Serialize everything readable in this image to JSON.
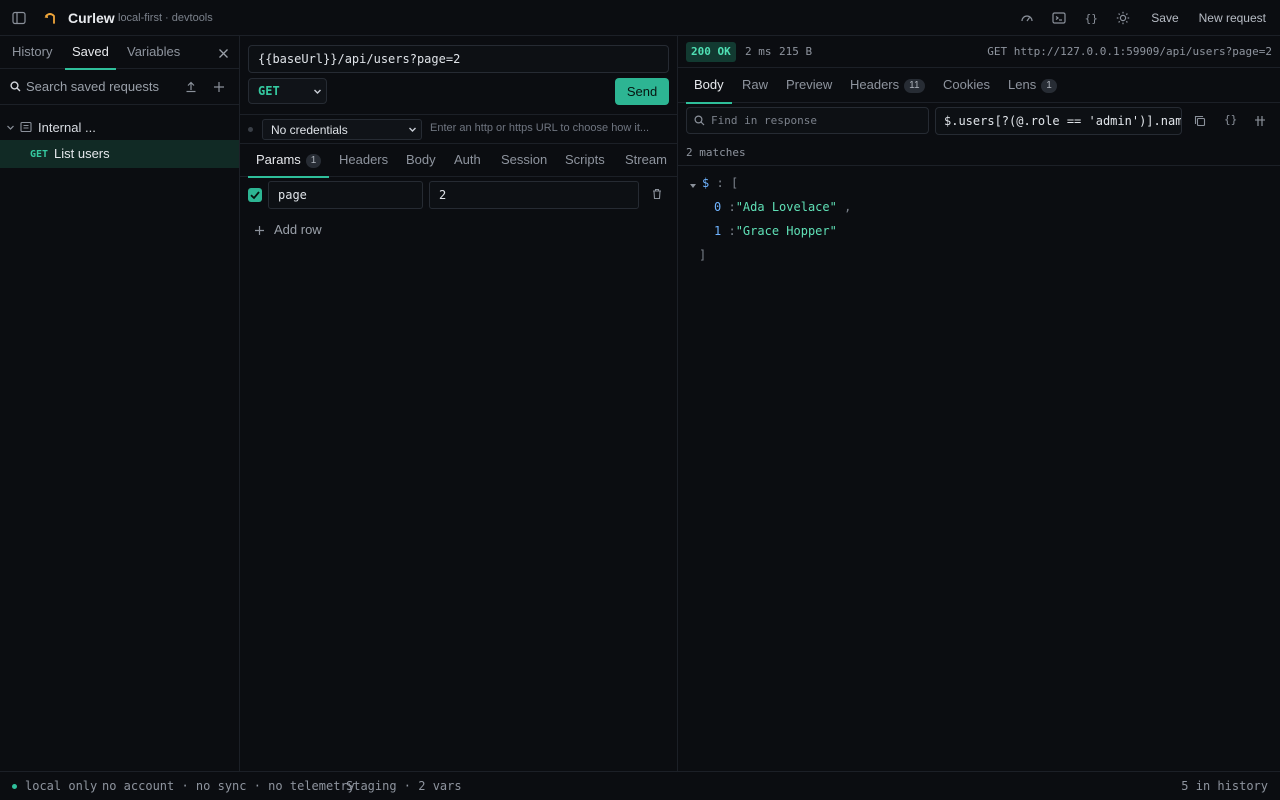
{
  "app": {
    "title": "Curlew",
    "subtitle": "local-first · devtools"
  },
  "topbar": {
    "save_label": "Save",
    "new_request_label": "New request"
  },
  "sidebar": {
    "tabs": [
      "History",
      "Saved",
      "Variables"
    ],
    "active_tab": "Saved",
    "search_placeholder": "Search saved requests",
    "folder_name": "Internal ...",
    "items": [
      {
        "method": "GET",
        "name": "List users"
      }
    ]
  },
  "request": {
    "url": "{{baseUrl}}/api/users?page=2",
    "method": "GET",
    "send_label": "Send",
    "credentials": "No credentials",
    "url_hint": "Enter an http or https URL to choose how it...",
    "tabs": [
      {
        "label": "Params",
        "badge": "1"
      },
      {
        "label": "Headers"
      },
      {
        "label": "Body"
      },
      {
        "label": "Auth"
      },
      {
        "label": "Session"
      },
      {
        "label": "Scripts"
      },
      {
        "label": "Stream"
      }
    ],
    "params": [
      {
        "key": "page",
        "value": "2",
        "enabled": true
      }
    ],
    "add_row_label": "Add row"
  },
  "response": {
    "status": "200 OK",
    "time": "2 ms",
    "size": "215 B",
    "request_line": "GET http://127.0.0.1:59909/api/users?page=2",
    "tabs": [
      {
        "label": "Body"
      },
      {
        "label": "Raw"
      },
      {
        "label": "Preview"
      },
      {
        "label": "Headers",
        "badge": "11"
      },
      {
        "label": "Cookies"
      },
      {
        "label": "Lens",
        "badge": "1"
      }
    ],
    "find_placeholder": "Find in response",
    "query": "$.users[?(@.role == 'admin')].name",
    "matches": "2 matches",
    "json": {
      "root_key": "$",
      "open_bracket": "[",
      "close_bracket": "]",
      "items": [
        {
          "index": "0",
          "value": "\"Ada Lovelace\""
        },
        {
          "index": "1",
          "value": "\"Grace Hopper\""
        }
      ]
    }
  },
  "statusbar": {
    "local_only": "local only",
    "privacy": "no account · no sync · no telemetry",
    "environment": "Staging · 2 vars",
    "history_count": "5 in history"
  },
  "colors": {
    "accent": "#2fbf9b",
    "background": "#0b0d11",
    "status_ok": "#4fe0b4"
  }
}
